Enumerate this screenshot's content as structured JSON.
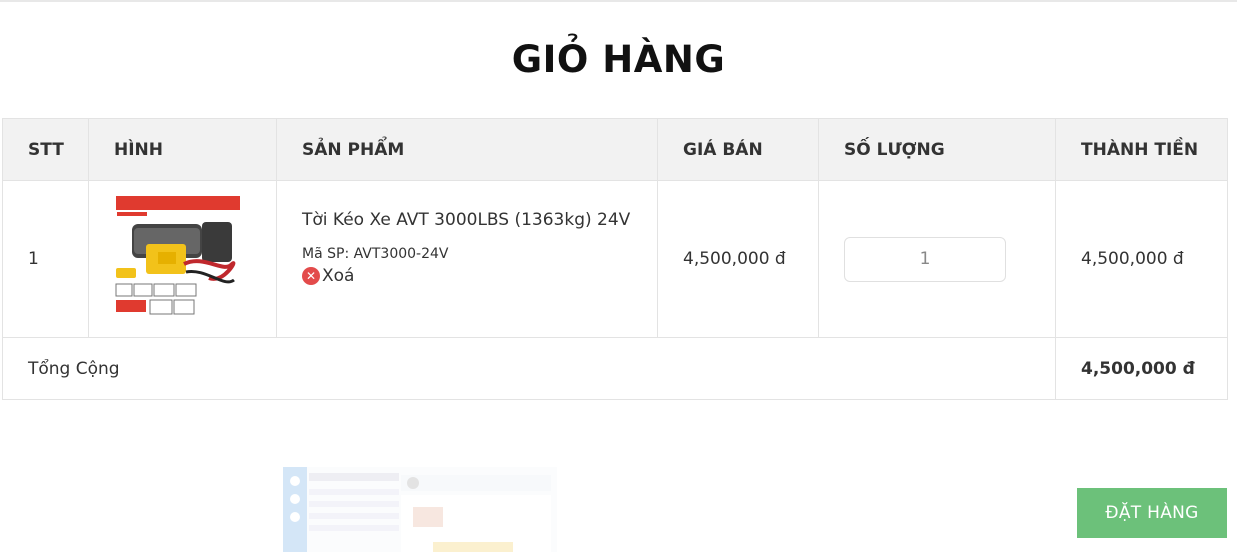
{
  "page": {
    "title": "GIỎ HÀNG"
  },
  "table": {
    "headers": [
      "STT",
      "HÌNH",
      "SẢN PHẨM",
      "GIÁ BÁN",
      "SỐ LƯỢNG",
      "THÀNH TIỀN"
    ],
    "rows": [
      {
        "index": "1",
        "image_icon": "winch-product-image",
        "name": "Tời Kéo Xe AVT 3000LBS (1363kg) 24V",
        "sku": "Mã SP: AVT3000-24V",
        "remove_label": "Xoá",
        "price": "4,500,000 đ",
        "quantity": "1",
        "subtotal": "4,500,000 đ"
      }
    ],
    "total_label": "Tổng Cộng",
    "total_value": "4,500,000 đ"
  },
  "actions": {
    "order_label": "ĐẶT HÀNG"
  },
  "colors": {
    "order_button": "#6cc17a",
    "remove_icon": "#e34b4b",
    "header_bg": "#f2f2f2"
  }
}
